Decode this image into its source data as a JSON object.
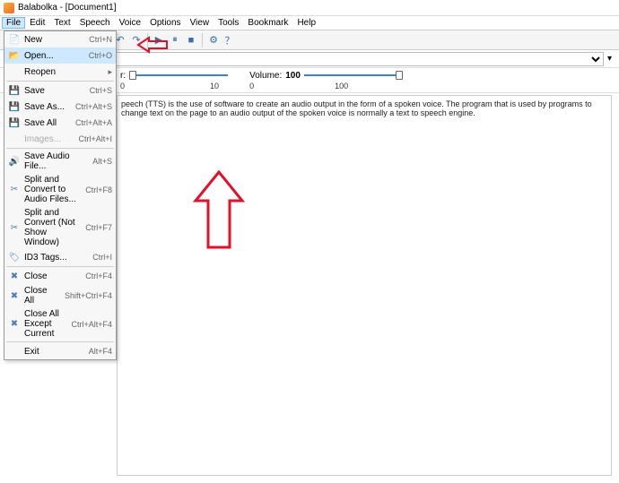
{
  "title": "Balabolka - [Document1]",
  "menus": [
    "File",
    "Edit",
    "Text",
    "Speech",
    "Voice",
    "Options",
    "View",
    "Tools",
    "Bookmark",
    "Help"
  ],
  "file_menu": [
    {
      "icon": "new",
      "label": "New",
      "shortcut": "Ctrl+N"
    },
    {
      "icon": "open",
      "label": "Open...",
      "shortcut": "Ctrl+O",
      "highlight": true
    },
    {
      "icon": "",
      "label": "Reopen",
      "shortcut": "",
      "sub": "▸"
    },
    {
      "sep": true
    },
    {
      "icon": "save",
      "label": "Save",
      "shortcut": "Ctrl+S"
    },
    {
      "icon": "saveas",
      "label": "Save As...",
      "shortcut": "Ctrl+Alt+S"
    },
    {
      "icon": "saveall",
      "label": "Save All",
      "shortcut": "Ctrl+Alt+A"
    },
    {
      "icon": "",
      "label": "Images...",
      "shortcut": "Ctrl+Alt+I",
      "disabled": true
    },
    {
      "sep": true
    },
    {
      "icon": "audio",
      "label": "Save Audio File...",
      "shortcut": "Alt+S"
    },
    {
      "icon": "split",
      "label": "Split and Convert to Audio Files...",
      "shortcut": "Ctrl+F8"
    },
    {
      "icon": "split2",
      "label": "Split and Convert (Not Show Window)",
      "shortcut": "Ctrl+F7"
    },
    {
      "icon": "id3",
      "label": "ID3 Tags...",
      "shortcut": "Ctrl+I"
    },
    {
      "sep": true
    },
    {
      "icon": "close",
      "label": "Close",
      "shortcut": "Ctrl+F4"
    },
    {
      "icon": "closeall",
      "label": "Close All",
      "shortcut": "Shift+Ctrl+F4"
    },
    {
      "icon": "closeexc",
      "label": "Close All Except Current",
      "shortcut": "Ctrl+Alt+F4"
    },
    {
      "sep": true
    },
    {
      "icon": "",
      "label": "Exit",
      "shortcut": "Alt+F4"
    }
  ],
  "sliders": {
    "rate": {
      "label": "r:",
      "min": "0",
      "max": "10",
      "value": 0
    },
    "volume": {
      "label": "Volume:",
      "min": "0",
      "max": "100",
      "value": 100,
      "bold": "100"
    }
  },
  "body_text": "peech (TTS) is the use of software to create an audio output in the form of a spoken voice. The program that is used by programs to change text on the page to an audio output of the spoken voice is normally a text to speech engine.",
  "dropdown_button": "▾"
}
